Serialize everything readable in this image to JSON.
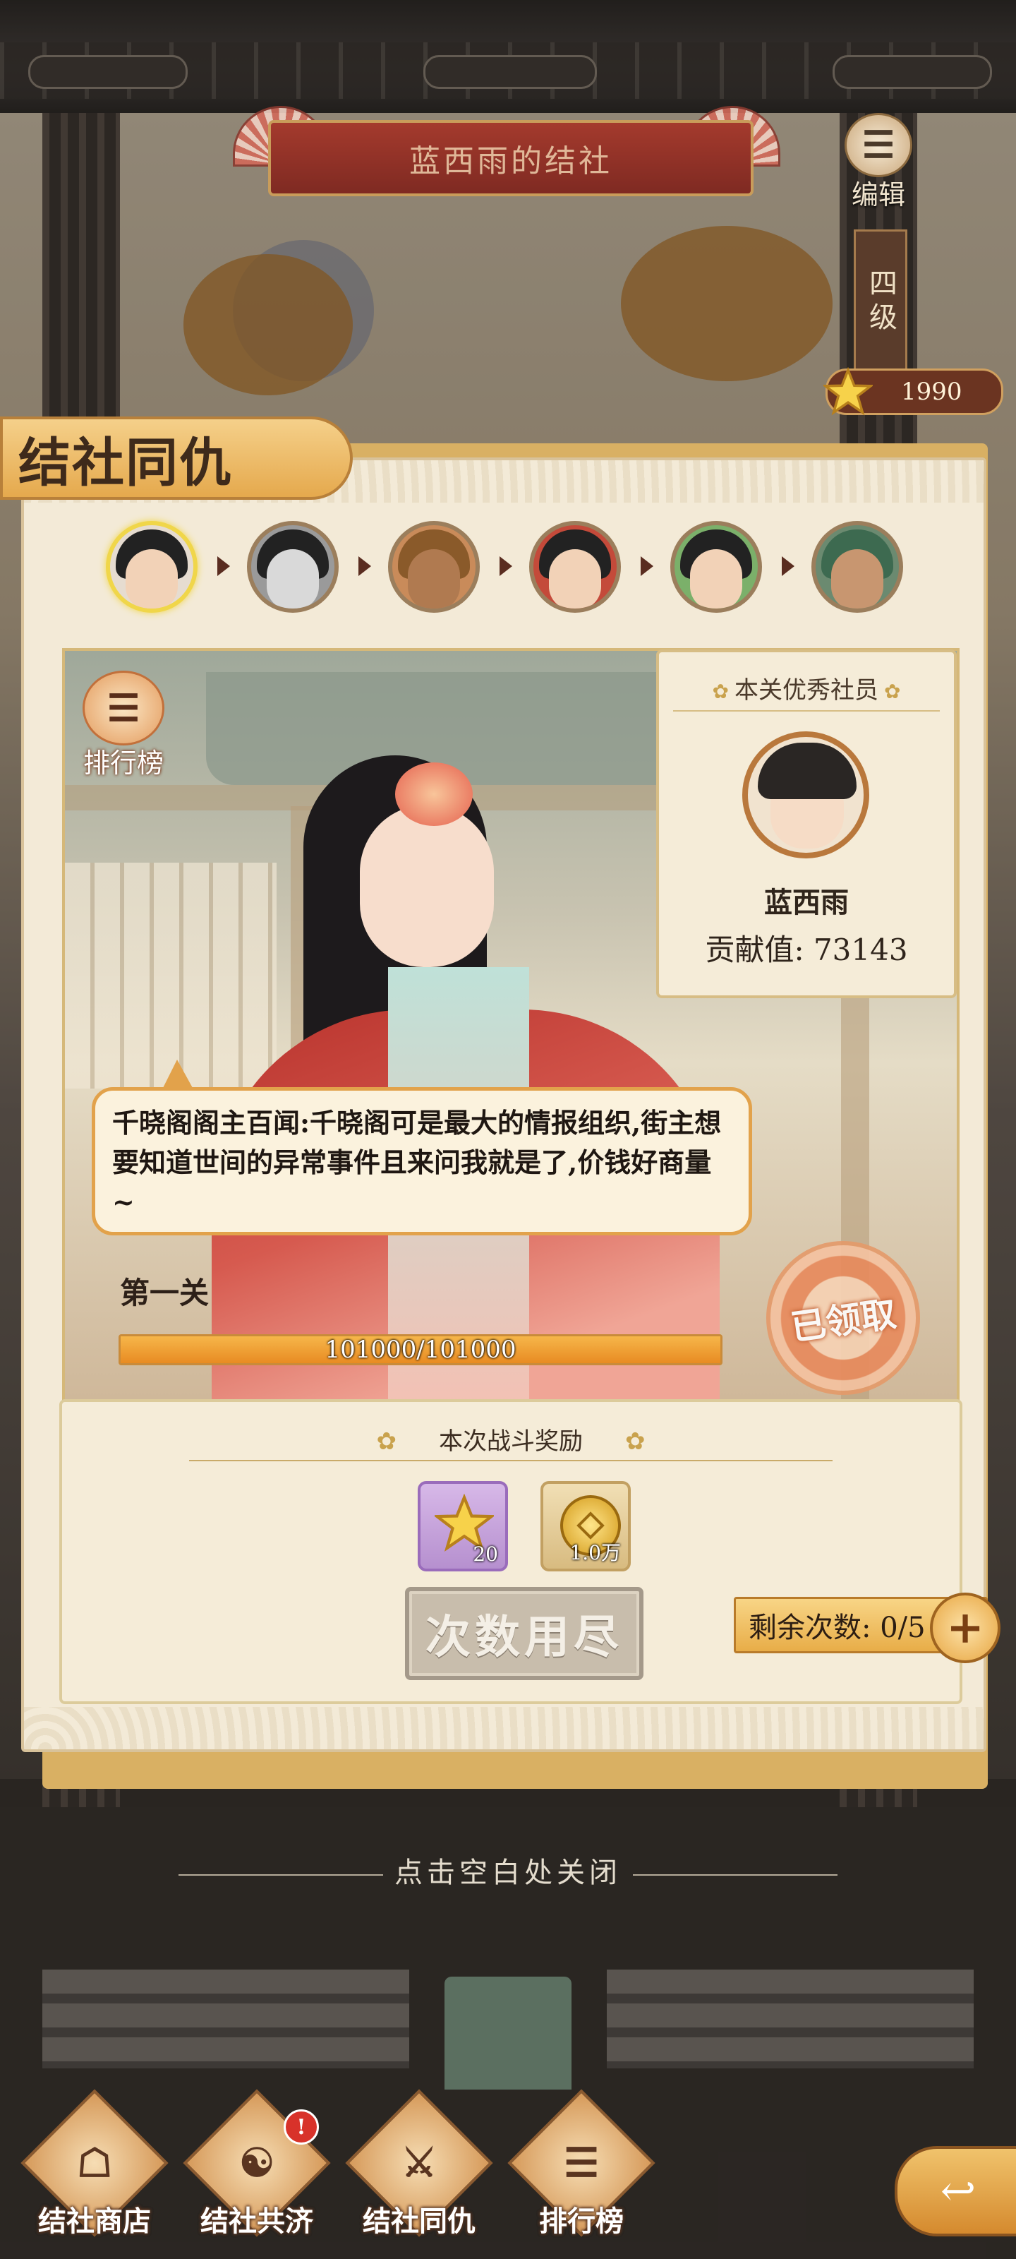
{
  "header": {
    "club_title": "蓝西雨的结社",
    "edit_label": "编辑",
    "club_level": "四级",
    "star_points": "1990"
  },
  "panel": {
    "title": "结社同仇",
    "stage_avatars": [
      {
        "state": "active"
      },
      {
        "state": "locked"
      },
      {
        "state": "locked"
      },
      {
        "state": "locked"
      },
      {
        "state": "locked"
      },
      {
        "state": "locked"
      }
    ]
  },
  "stage": {
    "ranking_label": "排行榜",
    "mvp": {
      "title": "本关优秀社员",
      "name": "蓝西雨",
      "score_label": "贡献值: 73143"
    },
    "dialogue": "千晓阁阁主百闻:千晓阁可是最大的情报组织,街主想要知道世间的异常事件且来问我就是了,价钱好商量~",
    "stage_name": "第一关",
    "hp_text": "101000/101000",
    "hp_fraction": 1.0,
    "claimed_label": "已领取"
  },
  "reward": {
    "title": "本次战斗奖励",
    "items": [
      {
        "icon": "star-icon",
        "qty": "20"
      },
      {
        "icon": "coin-icon",
        "qty": "1.0万"
      }
    ],
    "used_up_label": "次数用尽",
    "remaining_label": "剩余次数: 0/5",
    "plus_icon": "plus-icon"
  },
  "close_hint": "点击空白处关闭",
  "nav": {
    "items": [
      {
        "label": "结社商店",
        "icon": "shop-icon",
        "glyph": "☖"
      },
      {
        "label": "结社共济",
        "icon": "aid-icon",
        "glyph": "☯",
        "badge": "!"
      },
      {
        "label": "结社同仇",
        "icon": "battle-icon",
        "glyph": "⚔"
      },
      {
        "label": "排行榜",
        "icon": "rank-icon",
        "glyph": "☰"
      }
    ],
    "back_icon": "back-arrow-icon"
  },
  "colors": {
    "accent_orange": "#e8ad48",
    "banner_red": "#a43a2d",
    "panel_cream": "#f3ead7"
  }
}
